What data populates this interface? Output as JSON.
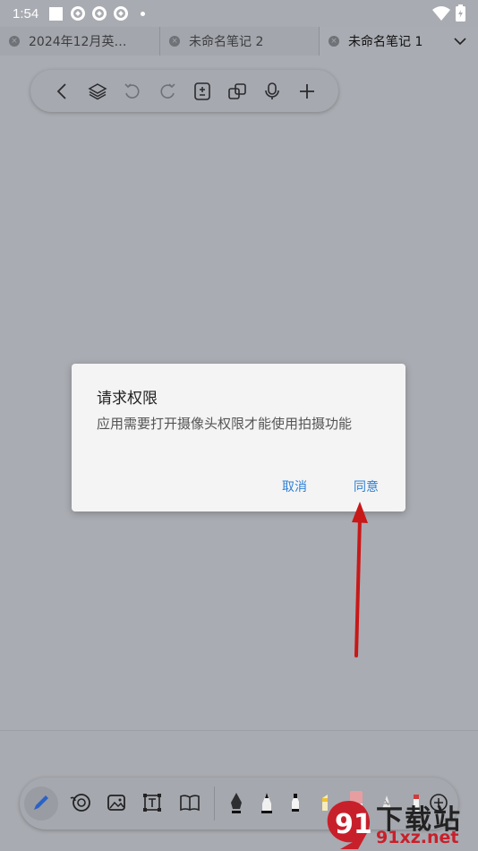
{
  "status_bar": {
    "time": "1:54"
  },
  "tabs": [
    {
      "label": "2024年12月英…"
    },
    {
      "label": "未命名笔记 2"
    },
    {
      "label": "未命名笔记 1"
    }
  ],
  "toolbar_icons": [
    "back-icon",
    "layers-icon",
    "undo-icon",
    "redo-icon",
    "page-icon",
    "copy-icon",
    "mic-icon",
    "plus-icon"
  ],
  "dialog": {
    "title": "请求权限",
    "message": "应用需要打开摄像头权限才能使用拍摄功能",
    "cancel": "取消",
    "confirm": "同意"
  },
  "bottom_tools": [
    "pen-icon",
    "lasso-icon",
    "image-icon",
    "text-box-icon",
    "book-icon",
    "fountain-pen-icon",
    "pencil-icon",
    "marker-icon",
    "highlighter-icon",
    "eraser-icon",
    "brush-icon",
    "add-tool-icon"
  ],
  "watermark": {
    "logo_text": "91",
    "big": "下载站",
    "small": "91xz.net"
  },
  "colors": {
    "accent": "#2f80d1",
    "annotation_arrow": "#d11c1c"
  }
}
